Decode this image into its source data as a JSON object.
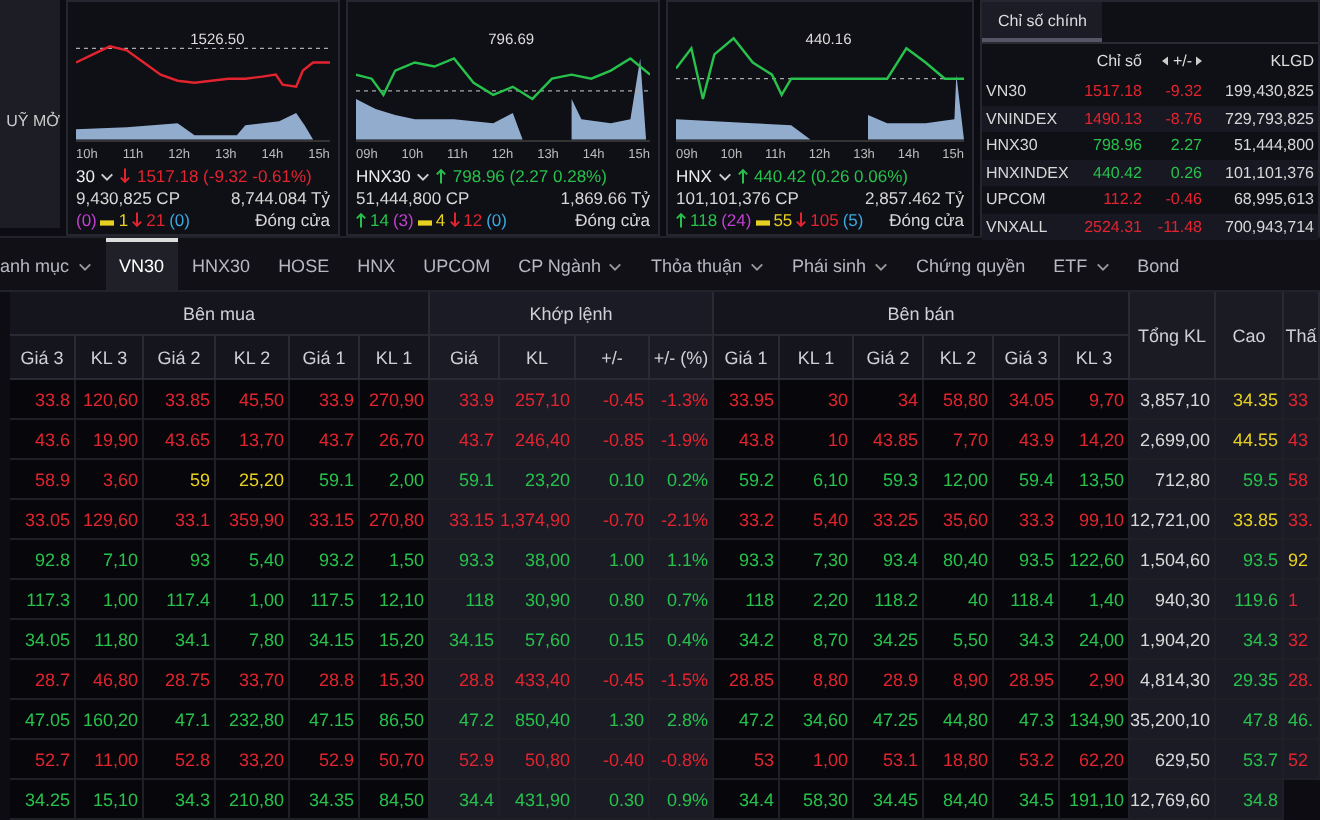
{
  "menu_overlay": {
    "label": "UỸ MỞ"
  },
  "index_charts": [
    {
      "name": "30",
      "kind": "down",
      "color": "#e3242f",
      "change": "1517.18 (-9.32 -0.61%)",
      "reference": "1526.50",
      "times": [
        "10h",
        "11h",
        "12h",
        "13h",
        "14h",
        "15h"
      ],
      "volume": "9,430,825 CP",
      "value": "8,744.084 Tỷ",
      "stats": [
        {
          "text": "(0)",
          "kind": "ceiling"
        },
        {
          "text": "1",
          "kind": "unchanged"
        },
        {
          "text": "21",
          "kind": "down"
        },
        {
          "text": "(0)",
          "kind": "floor"
        }
      ],
      "status": "Đóng cửa"
    },
    {
      "name": "HNX30",
      "kind": "up",
      "color": "#27c24c",
      "change": "798.96 (2.27 0.28%)",
      "reference": "796.69",
      "times": [
        "09h",
        "10h",
        "11h",
        "12h",
        "13h",
        "14h",
        "15h"
      ],
      "volume": "51,444,800 CP",
      "value": "1,869.66 Tỷ",
      "stats": [
        {
          "text": "14",
          "kind": "up"
        },
        {
          "text": "(3)",
          "kind": "ceiling"
        },
        {
          "text": "4",
          "kind": "unchanged"
        },
        {
          "text": "12",
          "kind": "down"
        },
        {
          "text": "(0)",
          "kind": "floor"
        }
      ],
      "status": "Đóng cửa"
    },
    {
      "name": "HNX",
      "kind": "up",
      "color": "#27c24c",
      "change": "440.42 (0.26 0.06%)",
      "reference": "440.16",
      "times": [
        "09h",
        "10h",
        "11h",
        "12h",
        "13h",
        "14h",
        "15h"
      ],
      "volume": "101,101,376 CP",
      "value": "2,857.462 Tỷ",
      "stats": [
        {
          "text": "118",
          "kind": "up"
        },
        {
          "text": "(24)",
          "kind": "ceiling"
        },
        {
          "text": "55",
          "kind": "unchanged"
        },
        {
          "text": "105",
          "kind": "down"
        },
        {
          "text": "(5)",
          "kind": "floor"
        }
      ],
      "status": "Đóng cửa"
    }
  ],
  "index_table": {
    "tab": {
      "label": "Chỉ số chính",
      "selected": true
    },
    "columns": [
      "Chỉ số",
      "+/-",
      "KLGD"
    ],
    "rows": [
      {
        "name": "VN30",
        "value": "1517.18",
        "change": "-9.32",
        "volume": "199,430,825",
        "color": "#e3242f"
      },
      {
        "name": "VNINDEX",
        "value": "1490.13",
        "change": "-8.76",
        "volume": "729,793,825",
        "color": "#e3242f"
      },
      {
        "name": "HNX30",
        "value": "798.96",
        "change": "2.27",
        "volume": "51,444,800",
        "color": "#27c24c"
      },
      {
        "name": "HNXINDEX",
        "value": "440.42",
        "change": "0.26",
        "volume": "101,101,376",
        "color": "#27c24c"
      },
      {
        "name": "UPCOM",
        "value": "112.2",
        "change": "-0.46",
        "volume": "68,995,613",
        "color": "#e3242f"
      },
      {
        "name": "VNXALL",
        "value": "2524.31",
        "change": "-11.48",
        "volume": "700,943,714",
        "color": "#e3242f"
      }
    ]
  },
  "tabs": [
    {
      "label": "anh mục",
      "dropdown": true,
      "selected": false
    },
    {
      "label": "VN30",
      "dropdown": false,
      "selected": true
    },
    {
      "label": "HNX30",
      "dropdown": false,
      "selected": false
    },
    {
      "label": "HOSE",
      "dropdown": false,
      "selected": false
    },
    {
      "label": "HNX",
      "dropdown": false,
      "selected": false
    },
    {
      "label": "UPCOM",
      "dropdown": false,
      "selected": false
    },
    {
      "label": "CP Ngành",
      "dropdown": true,
      "selected": false
    },
    {
      "label": "Thỏa thuận",
      "dropdown": true,
      "selected": false
    },
    {
      "label": "Phái sinh",
      "dropdown": true,
      "selected": false
    },
    {
      "label": "Chứng quyền",
      "dropdown": false,
      "selected": false
    },
    {
      "label": "ETF",
      "dropdown": true,
      "selected": false
    },
    {
      "label": "Bond",
      "dropdown": false,
      "selected": false
    }
  ],
  "board": {
    "groups": [
      "Bên mua",
      "Khớp lệnh",
      "Bên bán"
    ],
    "columns": [
      "Giá 3",
      "KL 3",
      "Giá 2",
      "KL 2",
      "Giá 1",
      "KL 1",
      "Giá",
      "KL",
      "+/-",
      "+/- (%)",
      "Giá 1",
      "KL 1",
      "Giá 2",
      "KL 2",
      "Giá 3",
      "KL 3"
    ],
    "extra_columns": [
      "Tổng KL",
      "Cao",
      "Thấ"
    ],
    "rows": [
      {
        "cells": [
          {
            "text": "33.8",
            "color": "#e3242f"
          },
          {
            "text": "120,60",
            "color": "#e3242f"
          },
          {
            "text": "33.85",
            "color": "#e3242f"
          },
          {
            "text": "45,50",
            "color": "#e3242f"
          },
          {
            "text": "33.9",
            "color": "#e3242f"
          },
          {
            "text": "270,90",
            "color": "#e3242f"
          },
          {
            "text": "33.9",
            "color": "#e3242f"
          },
          {
            "text": "257,10",
            "color": "#e3242f"
          },
          {
            "text": "-0.45",
            "color": "#e3242f"
          },
          {
            "text": "-1.3%",
            "color": "#e3242f"
          },
          {
            "text": "33.95",
            "color": "#e3242f"
          },
          {
            "text": "30",
            "color": "#e3242f"
          },
          {
            "text": "34",
            "color": "#e3242f"
          },
          {
            "text": "58,80",
            "color": "#e3242f"
          },
          {
            "text": "34.05",
            "color": "#e3242f"
          },
          {
            "text": "9,70",
            "color": "#e3242f"
          },
          {
            "text": "3,857,10",
            "color": "#d8d8d8"
          },
          {
            "text": "34.35",
            "color": "#e8d020"
          },
          {
            "text": "33",
            "color": "#e3242f"
          }
        ]
      },
      {
        "cells": [
          {
            "text": "43.6",
            "color": "#e3242f"
          },
          {
            "text": "19,90",
            "color": "#e3242f"
          },
          {
            "text": "43.65",
            "color": "#e3242f"
          },
          {
            "text": "13,70",
            "color": "#e3242f"
          },
          {
            "text": "43.7",
            "color": "#e3242f"
          },
          {
            "text": "26,70",
            "color": "#e3242f"
          },
          {
            "text": "43.7",
            "color": "#e3242f"
          },
          {
            "text": "246,40",
            "color": "#e3242f"
          },
          {
            "text": "-0.85",
            "color": "#e3242f"
          },
          {
            "text": "-1.9%",
            "color": "#e3242f"
          },
          {
            "text": "43.8",
            "color": "#e3242f"
          },
          {
            "text": "10",
            "color": "#e3242f"
          },
          {
            "text": "43.85",
            "color": "#e3242f"
          },
          {
            "text": "7,70",
            "color": "#e3242f"
          },
          {
            "text": "43.9",
            "color": "#e3242f"
          },
          {
            "text": "14,20",
            "color": "#e3242f"
          },
          {
            "text": "2,699,00",
            "color": "#d8d8d8"
          },
          {
            "text": "44.55",
            "color": "#e8d020"
          },
          {
            "text": "43",
            "color": "#e3242f"
          }
        ]
      },
      {
        "cells": [
          {
            "text": "58.9",
            "color": "#e3242f"
          },
          {
            "text": "3,60",
            "color": "#e3242f"
          },
          {
            "text": "59",
            "color": "#e8d020"
          },
          {
            "text": "25,20",
            "color": "#e8d020"
          },
          {
            "text": "59.1",
            "color": "#27c24c"
          },
          {
            "text": "2,00",
            "color": "#27c24c"
          },
          {
            "text": "59.1",
            "color": "#27c24c"
          },
          {
            "text": "23,20",
            "color": "#27c24c"
          },
          {
            "text": "0.10",
            "color": "#27c24c"
          },
          {
            "text": "0.2%",
            "color": "#27c24c"
          },
          {
            "text": "59.2",
            "color": "#27c24c"
          },
          {
            "text": "6,10",
            "color": "#27c24c"
          },
          {
            "text": "59.3",
            "color": "#27c24c"
          },
          {
            "text": "12,00",
            "color": "#27c24c"
          },
          {
            "text": "59.4",
            "color": "#27c24c"
          },
          {
            "text": "13,50",
            "color": "#27c24c"
          },
          {
            "text": "712,80",
            "color": "#d8d8d8"
          },
          {
            "text": "59.5",
            "color": "#27c24c"
          },
          {
            "text": "58",
            "color": "#e3242f"
          }
        ]
      },
      {
        "cells": [
          {
            "text": "33.05",
            "color": "#e3242f"
          },
          {
            "text": "129,60",
            "color": "#e3242f"
          },
          {
            "text": "33.1",
            "color": "#e3242f"
          },
          {
            "text": "359,90",
            "color": "#e3242f"
          },
          {
            "text": "33.15",
            "color": "#e3242f"
          },
          {
            "text": "270,80",
            "color": "#e3242f"
          },
          {
            "text": "33.15",
            "color": "#e3242f"
          },
          {
            "text": "1,374,90",
            "color": "#e3242f"
          },
          {
            "text": "-0.70",
            "color": "#e3242f"
          },
          {
            "text": "-2.1%",
            "color": "#e3242f"
          },
          {
            "text": "33.2",
            "color": "#e3242f"
          },
          {
            "text": "5,40",
            "color": "#e3242f"
          },
          {
            "text": "33.25",
            "color": "#e3242f"
          },
          {
            "text": "35,60",
            "color": "#e3242f"
          },
          {
            "text": "33.3",
            "color": "#e3242f"
          },
          {
            "text": "99,10",
            "color": "#e3242f"
          },
          {
            "text": "12,721,00",
            "color": "#d8d8d8"
          },
          {
            "text": "33.85",
            "color": "#e8d020"
          },
          {
            "text": "33.",
            "color": "#e3242f"
          }
        ]
      },
      {
        "cells": [
          {
            "text": "92.8",
            "color": "#27c24c"
          },
          {
            "text": "7,10",
            "color": "#27c24c"
          },
          {
            "text": "93",
            "color": "#27c24c"
          },
          {
            "text": "5,40",
            "color": "#27c24c"
          },
          {
            "text": "93.2",
            "color": "#27c24c"
          },
          {
            "text": "1,50",
            "color": "#27c24c"
          },
          {
            "text": "93.3",
            "color": "#27c24c"
          },
          {
            "text": "38,00",
            "color": "#27c24c"
          },
          {
            "text": "1.00",
            "color": "#27c24c"
          },
          {
            "text": "1.1%",
            "color": "#27c24c"
          },
          {
            "text": "93.3",
            "color": "#27c24c"
          },
          {
            "text": "7,30",
            "color": "#27c24c"
          },
          {
            "text": "93.4",
            "color": "#27c24c"
          },
          {
            "text": "80,40",
            "color": "#27c24c"
          },
          {
            "text": "93.5",
            "color": "#27c24c"
          },
          {
            "text": "122,60",
            "color": "#27c24c"
          },
          {
            "text": "1,504,60",
            "color": "#d8d8d8"
          },
          {
            "text": "93.5",
            "color": "#27c24c"
          },
          {
            "text": "92",
            "color": "#e8d020"
          }
        ]
      },
      {
        "cells": [
          {
            "text": "117.3",
            "color": "#27c24c"
          },
          {
            "text": "1,00",
            "color": "#27c24c"
          },
          {
            "text": "117.4",
            "color": "#27c24c"
          },
          {
            "text": "1,00",
            "color": "#27c24c"
          },
          {
            "text": "117.5",
            "color": "#27c24c"
          },
          {
            "text": "12,10",
            "color": "#27c24c"
          },
          {
            "text": "118",
            "color": "#27c24c"
          },
          {
            "text": "30,90",
            "color": "#27c24c"
          },
          {
            "text": "0.80",
            "color": "#27c24c"
          },
          {
            "text": "0.7%",
            "color": "#27c24c"
          },
          {
            "text": "118",
            "color": "#27c24c"
          },
          {
            "text": "2,20",
            "color": "#27c24c"
          },
          {
            "text": "118.2",
            "color": "#27c24c"
          },
          {
            "text": "40",
            "color": "#27c24c"
          },
          {
            "text": "118.4",
            "color": "#27c24c"
          },
          {
            "text": "1,40",
            "color": "#27c24c"
          },
          {
            "text": "940,30",
            "color": "#d8d8d8"
          },
          {
            "text": "119.6",
            "color": "#27c24c"
          },
          {
            "text": "1",
            "color": "#e3242f"
          }
        ]
      },
      {
        "cells": [
          {
            "text": "34.05",
            "color": "#27c24c"
          },
          {
            "text": "11,80",
            "color": "#27c24c"
          },
          {
            "text": "34.1",
            "color": "#27c24c"
          },
          {
            "text": "7,80",
            "color": "#27c24c"
          },
          {
            "text": "34.15",
            "color": "#27c24c"
          },
          {
            "text": "15,20",
            "color": "#27c24c"
          },
          {
            "text": "34.15",
            "color": "#27c24c"
          },
          {
            "text": "57,60",
            "color": "#27c24c"
          },
          {
            "text": "0.15",
            "color": "#27c24c"
          },
          {
            "text": "0.4%",
            "color": "#27c24c"
          },
          {
            "text": "34.2",
            "color": "#27c24c"
          },
          {
            "text": "8,70",
            "color": "#27c24c"
          },
          {
            "text": "34.25",
            "color": "#27c24c"
          },
          {
            "text": "5,50",
            "color": "#27c24c"
          },
          {
            "text": "34.3",
            "color": "#27c24c"
          },
          {
            "text": "24,00",
            "color": "#27c24c"
          },
          {
            "text": "1,904,20",
            "color": "#d8d8d8"
          },
          {
            "text": "34.3",
            "color": "#27c24c"
          },
          {
            "text": "32",
            "color": "#e3242f"
          }
        ]
      },
      {
        "cells": [
          {
            "text": "28.7",
            "color": "#e3242f"
          },
          {
            "text": "46,80",
            "color": "#e3242f"
          },
          {
            "text": "28.75",
            "color": "#e3242f"
          },
          {
            "text": "33,70",
            "color": "#e3242f"
          },
          {
            "text": "28.8",
            "color": "#e3242f"
          },
          {
            "text": "15,30",
            "color": "#e3242f"
          },
          {
            "text": "28.8",
            "color": "#e3242f"
          },
          {
            "text": "433,40",
            "color": "#e3242f"
          },
          {
            "text": "-0.45",
            "color": "#e3242f"
          },
          {
            "text": "-1.5%",
            "color": "#e3242f"
          },
          {
            "text": "28.85",
            "color": "#e3242f"
          },
          {
            "text": "8,80",
            "color": "#e3242f"
          },
          {
            "text": "28.9",
            "color": "#e3242f"
          },
          {
            "text": "8,90",
            "color": "#e3242f"
          },
          {
            "text": "28.95",
            "color": "#e3242f"
          },
          {
            "text": "2,90",
            "color": "#e3242f"
          },
          {
            "text": "4,814,30",
            "color": "#d8d8d8"
          },
          {
            "text": "29.35",
            "color": "#27c24c"
          },
          {
            "text": "28.",
            "color": "#e3242f"
          }
        ]
      },
      {
        "cells": [
          {
            "text": "47.05",
            "color": "#27c24c"
          },
          {
            "text": "160,20",
            "color": "#27c24c"
          },
          {
            "text": "47.1",
            "color": "#27c24c"
          },
          {
            "text": "232,80",
            "color": "#27c24c"
          },
          {
            "text": "47.15",
            "color": "#27c24c"
          },
          {
            "text": "86,50",
            "color": "#27c24c"
          },
          {
            "text": "47.2",
            "color": "#27c24c"
          },
          {
            "text": "850,40",
            "color": "#27c24c"
          },
          {
            "text": "1.30",
            "color": "#27c24c"
          },
          {
            "text": "2.8%",
            "color": "#27c24c"
          },
          {
            "text": "47.2",
            "color": "#27c24c"
          },
          {
            "text": "34,60",
            "color": "#27c24c"
          },
          {
            "text": "47.25",
            "color": "#27c24c"
          },
          {
            "text": "44,80",
            "color": "#27c24c"
          },
          {
            "text": "47.3",
            "color": "#27c24c"
          },
          {
            "text": "134,90",
            "color": "#27c24c"
          },
          {
            "text": "35,200,10",
            "color": "#d8d8d8"
          },
          {
            "text": "47.8",
            "color": "#27c24c"
          },
          {
            "text": "46.",
            "color": "#27c24c"
          }
        ]
      },
      {
        "cells": [
          {
            "text": "52.7",
            "color": "#e3242f"
          },
          {
            "text": "11,00",
            "color": "#e3242f"
          },
          {
            "text": "52.8",
            "color": "#e3242f"
          },
          {
            "text": "33,20",
            "color": "#e3242f"
          },
          {
            "text": "52.9",
            "color": "#e3242f"
          },
          {
            "text": "50,70",
            "color": "#e3242f"
          },
          {
            "text": "52.9",
            "color": "#e3242f"
          },
          {
            "text": "50,80",
            "color": "#e3242f"
          },
          {
            "text": "-0.40",
            "color": "#e3242f"
          },
          {
            "text": "-0.8%",
            "color": "#e3242f"
          },
          {
            "text": "53",
            "color": "#e3242f"
          },
          {
            "text": "1,00",
            "color": "#e3242f"
          },
          {
            "text": "53.1",
            "color": "#e3242f"
          },
          {
            "text": "18,80",
            "color": "#e3242f"
          },
          {
            "text": "53.2",
            "color": "#e3242f"
          },
          {
            "text": "62,20",
            "color": "#e3242f"
          },
          {
            "text": "629,50",
            "color": "#d8d8d8"
          },
          {
            "text": "53.7",
            "color": "#27c24c"
          },
          {
            "text": "52",
            "color": "#e3242f"
          }
        ]
      },
      {
        "cells": [
          {
            "text": "34.25",
            "color": "#27c24c"
          },
          {
            "text": "15,10",
            "color": "#27c24c"
          },
          {
            "text": "34.3",
            "color": "#27c24c"
          },
          {
            "text": "210,80",
            "color": "#27c24c"
          },
          {
            "text": "34.35",
            "color": "#27c24c"
          },
          {
            "text": "84,50",
            "color": "#27c24c"
          },
          {
            "text": "34.4",
            "color": "#27c24c"
          },
          {
            "text": "431,90",
            "color": "#27c24c"
          },
          {
            "text": "0.30",
            "color": "#27c24c"
          },
          {
            "text": "0.9%",
            "color": "#27c24c"
          },
          {
            "text": "34.4",
            "color": "#27c24c"
          },
          {
            "text": "58,30",
            "color": "#27c24c"
          },
          {
            "text": "34.45",
            "color": "#27c24c"
          },
          {
            "text": "84,40",
            "color": "#27c24c"
          },
          {
            "text": "34.5",
            "color": "#27c24c"
          },
          {
            "text": "191,10",
            "color": "#27c24c"
          },
          {
            "text": "12,769,60",
            "color": "#d8d8d8"
          },
          {
            "text": "34.8",
            "color": "#27c24c"
          }
        ]
      }
    ]
  }
}
